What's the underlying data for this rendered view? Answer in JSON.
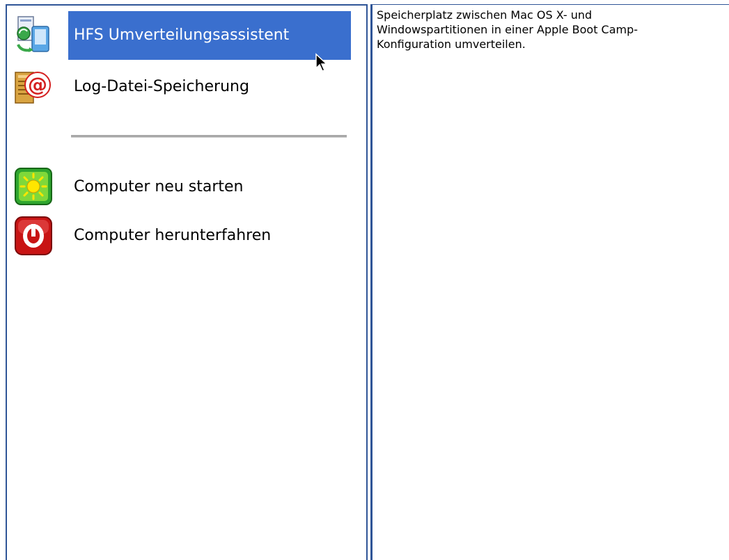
{
  "menu": {
    "items": [
      {
        "label": "HFS Umverteilungsassistent",
        "icon": "hfs-redistribute-icon",
        "selected": true
      },
      {
        "label": "Log-Datei-Speicherung",
        "icon": "log-file-icon",
        "selected": false
      },
      {
        "label": "Computer neu starten",
        "icon": "restart-icon",
        "selected": false
      },
      {
        "label": "Computer herunterfahren",
        "icon": "shutdown-icon",
        "selected": false
      }
    ]
  },
  "description": {
    "text": "Speicherplatz zwischen Mac OS X- und Windowspartitionen in einer Apple Boot Camp-Konfiguration umverteilen."
  },
  "colors": {
    "selection": "#3a6fce",
    "border": "#2f5597",
    "separator": "#a8a8a8"
  }
}
